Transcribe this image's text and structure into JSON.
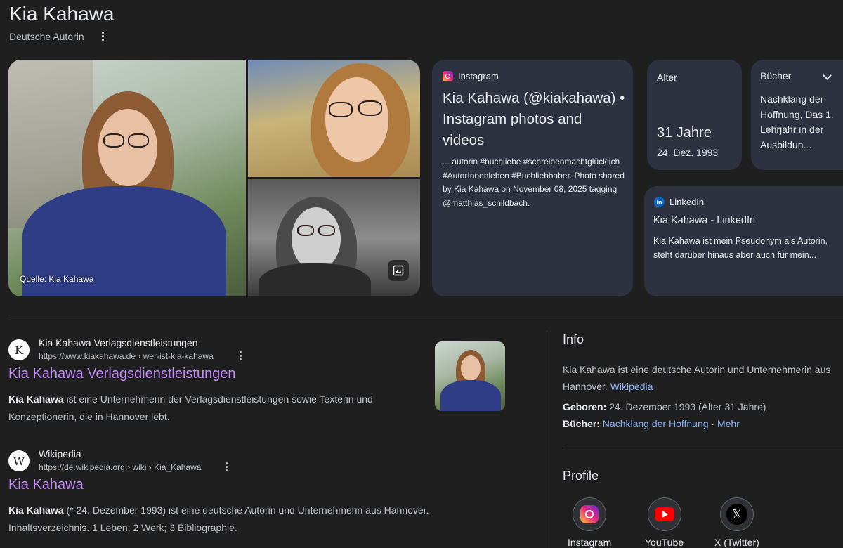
{
  "entity": {
    "name": "Kia Kahawa",
    "description": "Deutsche Autorin"
  },
  "photos": {
    "source_caption": "Quelle: Kia Kahawa"
  },
  "instagram_card": {
    "source": "Instagram",
    "title": "Kia Kahawa (@kiakahawa) • Instagram photos and videos",
    "snippet": "... autorin #buchliebe #schreibenmachtglücklich #AutorInnenleben #Buchliebhaber. Photo shared by Kia Kahawa on November 08, 2025 tagging @matthias_schildbach."
  },
  "age_card": {
    "label": "Alter",
    "value": "31 Jahre",
    "date": "24. Dez. 1993"
  },
  "books_card": {
    "label": "Bücher",
    "value": "Nachklang der Hoffnung, Das 1. Lehrjahr in der Ausbildun..."
  },
  "linkedin_card": {
    "source": "LinkedIn",
    "title": "Kia Kahawa - LinkedIn",
    "snippet": "Kia Kahawa ist mein Pseudonym als Autorin, steht darüber hinaus aber auch für mein..."
  },
  "results": [
    {
      "favicon": "K",
      "site_name": "Kia Kahawa Verlagsdienstleistungen",
      "url": "https://www.kiakahawa.de › wer-ist-kia-kahawa",
      "title": "Kia Kahawa Verlagsdienstleistungen",
      "snippet_bold": "Kia Kahawa",
      "snippet": " ist eine Unternehmerin der Verlagsdienstleistungen sowie Texterin und Konzeptionerin, die in Hannover lebt."
    },
    {
      "favicon": "W",
      "site_name": "Wikipedia",
      "url": "https://de.wikipedia.org › wiki › Kia_Kahawa",
      "title": "Kia Kahawa",
      "snippet_bold": "Kia Kahawa",
      "snippet": " (* 24. Dezember 1993) ist eine deutsche Autorin und Unternehmerin aus Hannover. Inhaltsverzeichnis. 1 Leben; 2 Werk; 3 Bibliographie."
    }
  ],
  "info": {
    "heading": "Info",
    "description": "Kia Kahawa ist eine deutsche Autorin und Unternehmerin aus Hannover.",
    "wiki_link": "Wikipedia",
    "born_label": "Geboren:",
    "born_value": "24. Dezember 1993 (Alter 31 Jahre)",
    "books_label": "Bücher:",
    "books_value": "Nachklang der Hoffnung",
    "separator": "·",
    "more_link": "Mehr"
  },
  "profiles": {
    "heading": "Profile",
    "items": [
      {
        "label": "Instagram",
        "icon": "instagram-icon"
      },
      {
        "label": "YouTube",
        "icon": "youtube-icon"
      },
      {
        "label": "X (Twitter)",
        "icon": "x-icon"
      }
    ]
  }
}
